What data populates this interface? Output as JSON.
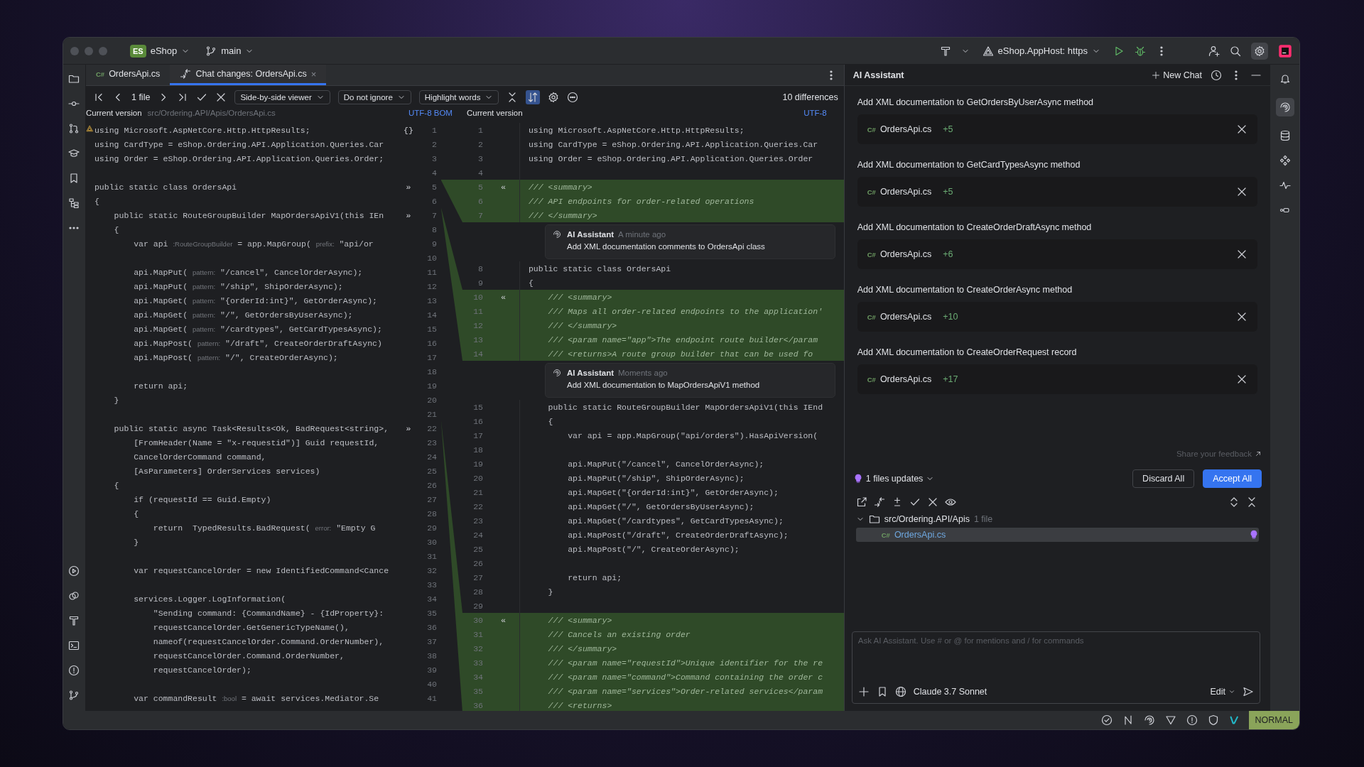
{
  "window": {
    "project_badge": "ES",
    "project": "eShop",
    "branch": "main",
    "run_config": "eShop.AppHost: https"
  },
  "tabs": [
    {
      "lang": "C#",
      "label": "OrdersApi.cs",
      "selected": false
    },
    {
      "label": "Chat changes: OrdersApi.cs",
      "close": "×",
      "selected": true
    }
  ],
  "diff_toolbar": {
    "file_count": "1 file",
    "viewer": "Side-by-side viewer",
    "whitespace": "Do not ignore",
    "highlight": "Highlight words",
    "sync_scroll": {
      "on": true
    },
    "differences": "10 differences"
  },
  "left_header": {
    "title": "Current version",
    "path": "src/Ordering.API/Apis/OrdersApi.cs",
    "encoding": "UTF-8 BOM"
  },
  "right_header": {
    "title": "Current version",
    "encoding": "UTF-8"
  },
  "left_lines": [
    {
      "number": "1",
      "marker": "{}",
      "code": "using Microsoft.AspNetCore.Http.HttpResults;"
    },
    {
      "number": "2",
      "code": "using CardType = eShop.Ordering.API.Application.Queries.Car"
    },
    {
      "number": "3",
      "code": "using Order = eShop.Ordering.API.Application.Queries.Order;"
    },
    {
      "number": "4"
    },
    {
      "number": "5",
      "marker": "»",
      "code": "public static class OrdersApi"
    },
    {
      "number": "6",
      "code": "{"
    },
    {
      "number": "7",
      "marker": "»",
      "code": "    public static RouteGroupBuilder MapOrdersApiV1(this IEn"
    },
    {
      "number": "8",
      "code": "    {"
    },
    {
      "number": "9",
      "code": "        var api *:RouteGroupBuilder* = app.MapGroup( *prefix:* \"api/or"
    },
    {
      "number": "10"
    },
    {
      "number": "11",
      "code": "        api.MapPut( *pattern:* \"/cancel\", CancelOrderAsync);"
    },
    {
      "number": "12",
      "code": "        api.MapPut( *pattern:* \"/ship\", ShipOrderAsync);"
    },
    {
      "number": "13",
      "code": "        api.MapGet( *pattern:* \"{orderId:int}\", GetOrderAsync);"
    },
    {
      "number": "14",
      "code": "        api.MapGet( *pattern:* \"/\", GetOrdersByUserAsync);"
    },
    {
      "number": "15",
      "code": "        api.MapGet( *pattern:* \"/cardtypes\", GetCardTypesAsync);"
    },
    {
      "number": "16",
      "code": "        api.MapPost( *pattern:* \"/draft\", CreateOrderDraftAsync)"
    },
    {
      "number": "17",
      "code": "        api.MapPost( *pattern:* \"/\", CreateOrderAsync);"
    },
    {
      "number": "18"
    },
    {
      "number": "19",
      "code": "        return api;"
    },
    {
      "number": "20",
      "code": "    }"
    },
    {
      "number": "21"
    },
    {
      "number": "22",
      "marker": "»",
      "code": "    public static async Task<Results<Ok, BadRequest<string>,"
    },
    {
      "number": "23",
      "code": "        [FromHeader(Name = \"x-requestid\")] Guid requestId,"
    },
    {
      "number": "24",
      "code": "        CancelOrderCommand command,"
    },
    {
      "number": "25",
      "code": "        [AsParameters] OrderServices services)"
    },
    {
      "number": "26",
      "code": "    {"
    },
    {
      "number": "27",
      "code": "        if (requestId == Guid.Empty)"
    },
    {
      "number": "28",
      "code": "        {"
    },
    {
      "number": "29",
      "code": "            return  TypedResults.BadRequest( *error:* \"Empty G"
    },
    {
      "number": "30",
      "code": "        }"
    },
    {
      "number": "31"
    },
    {
      "number": "32",
      "code": "        var requestCancelOrder = new IdentifiedCommand<Cance"
    },
    {
      "number": "33"
    },
    {
      "number": "34",
      "code": "        services.Logger.LogInformation("
    },
    {
      "number": "35",
      "code": "            \"Sending command: {CommandName} - {IdProperty}:"
    },
    {
      "number": "36",
      "code": "            requestCancelOrder.GetGenericTypeName(),"
    },
    {
      "number": "37",
      "code": "            nameof(requestCancelOrder.Command.OrderNumber),"
    },
    {
      "number": "38",
      "code": "            requestCancelOrder.Command.OrderNumber,"
    },
    {
      "number": "39",
      "code": "            requestCancelOrder);"
    },
    {
      "number": "40"
    },
    {
      "number": "41",
      "code": "        var commandResult *:bool* = await services.Mediator.Se"
    }
  ],
  "right_lines": [
    {
      "kind": "code",
      "number": "1",
      "code": "using Microsoft.AspNetCore.Http.HttpResults;"
    },
    {
      "kind": "code",
      "number": "2",
      "code": "using CardType = eShop.Ordering.API.Application.Queries.Car"
    },
    {
      "kind": "code",
      "number": "3",
      "code": "using Order = eShop.Ordering.API.Application.Queries.Order"
    },
    {
      "kind": "code",
      "number": "4"
    },
    {
      "kind": "added",
      "number": "5",
      "marker": "«",
      "code": "/// <summary>"
    },
    {
      "kind": "added",
      "number": "6",
      "code": "/// API endpoints for order-related operations"
    },
    {
      "kind": "added",
      "number": "7",
      "code": "/// </summary>"
    },
    {
      "kind": "comment",
      "author": "AI Assistant",
      "time": "A minute ago",
      "text": "Add XML documentation comments to OrdersApi class"
    },
    {
      "kind": "code",
      "number": "8",
      "code": "public static class OrdersApi"
    },
    {
      "kind": "code",
      "number": "9",
      "code": "{"
    },
    {
      "kind": "added",
      "number": "10",
      "marker": "«",
      "code": "    /// <summary>"
    },
    {
      "kind": "added",
      "number": "11",
      "code": "    /// Maps all order-related endpoints to the application'"
    },
    {
      "kind": "added",
      "number": "12",
      "code": "    /// </summary>"
    },
    {
      "kind": "added",
      "number": "13",
      "code": "    /// <param name=\"app\">The endpoint route builder</param"
    },
    {
      "kind": "added",
      "number": "14",
      "code": "    /// <returns>A route group builder that can be used fo"
    },
    {
      "kind": "comment",
      "author": "AI Assistant",
      "time": "Moments ago",
      "text": "Add XML documentation to MapOrdersApiV1 method"
    },
    {
      "kind": "code",
      "number": "15",
      "code": "    public static RouteGroupBuilder MapOrdersApiV1(this IEnd"
    },
    {
      "kind": "code",
      "number": "16",
      "code": "    {"
    },
    {
      "kind": "code",
      "number": "17",
      "code": "        var api = app.MapGroup(\"api/orders\").HasApiVersion("
    },
    {
      "kind": "code",
      "number": "18"
    },
    {
      "kind": "code",
      "number": "19",
      "code": "        api.MapPut(\"/cancel\", CancelOrderAsync);"
    },
    {
      "kind": "code",
      "number": "20",
      "code": "        api.MapPut(\"/ship\", ShipOrderAsync);"
    },
    {
      "kind": "code",
      "number": "21",
      "code": "        api.MapGet(\"{orderId:int}\", GetOrderAsync);"
    },
    {
      "kind": "code",
      "number": "22",
      "code": "        api.MapGet(\"/\", GetOrdersByUserAsync);"
    },
    {
      "kind": "code",
      "number": "23",
      "code": "        api.MapGet(\"/cardtypes\", GetCardTypesAsync);"
    },
    {
      "kind": "code",
      "number": "24",
      "code": "        api.MapPost(\"/draft\", CreateOrderDraftAsync);"
    },
    {
      "kind": "code",
      "number": "25",
      "code": "        api.MapPost(\"/\", CreateOrderAsync);"
    },
    {
      "kind": "code",
      "number": "26"
    },
    {
      "kind": "code",
      "number": "27",
      "code": "        return api;"
    },
    {
      "kind": "code",
      "number": "28",
      "code": "    }"
    },
    {
      "kind": "code",
      "number": "29"
    },
    {
      "kind": "added",
      "number": "30",
      "marker": "«",
      "code": "    /// <summary>"
    },
    {
      "kind": "added",
      "number": "31",
      "code": "    /// Cancels an existing order"
    },
    {
      "kind": "added",
      "number": "32",
      "code": "    /// </summary>"
    },
    {
      "kind": "added",
      "number": "33",
      "code": "    /// <param name=\"requestId\">Unique identifier for the re"
    },
    {
      "kind": "added",
      "number": "34",
      "code": "    /// <param name=\"command\">Command containing the order c"
    },
    {
      "kind": "added",
      "number": "35",
      "code": "    /// <param name=\"services\">Order-related services</param"
    },
    {
      "kind": "added",
      "number": "36",
      "code": "    /// <returns>"
    }
  ],
  "right_toolbar": [
    {
      "selected": false
    },
    {
      "selected": true
    },
    {
      "selected": false
    },
    {
      "selected": false
    },
    {
      "selected": false
    },
    {
      "selected": false
    }
  ],
  "ai_panel": {
    "title": "AI Assistant",
    "new_chat": "New Chat",
    "changes": [
      {
        "title": "Add XML documentation to GetOrdersByUserAsync method",
        "lang": "C#",
        "file": "OrdersApi.cs",
        "added": "+5"
      },
      {
        "title": "Add XML documentation to GetCardTypesAsync method",
        "lang": "C#",
        "file": "OrdersApi.cs",
        "added": "+5"
      },
      {
        "title": "Add XML documentation to CreateOrderDraftAsync method",
        "lang": "C#",
        "file": "OrdersApi.cs",
        "added": "+6"
      },
      {
        "title": "Add XML documentation to CreateOrderAsync method",
        "lang": "C#",
        "file": "OrdersApi.cs",
        "added": "+10"
      },
      {
        "title": "Add XML documentation to CreateOrderRequest record",
        "lang": "C#",
        "file": "OrdersApi.cs",
        "added": "+17"
      }
    ],
    "feedback": "Share your feedback",
    "updates": "1 files updates",
    "discard": "Discard All",
    "accept": "Accept All",
    "tree": [
      {
        "label": "src/Ordering.API/Apis",
        "count": "1 file",
        "expanded": true,
        "children": [
          {
            "lang": "C#",
            "label": "OrdersApi.cs",
            "selected": true
          }
        ]
      }
    ],
    "input": {
      "placeholder": "Ask AI Assistant. Use # or @ for mentions and / for commands",
      "model": "Claude 3.7 Sonnet",
      "mode": "Edit"
    }
  },
  "status_bar": {
    "mode": "NORMAL"
  }
}
